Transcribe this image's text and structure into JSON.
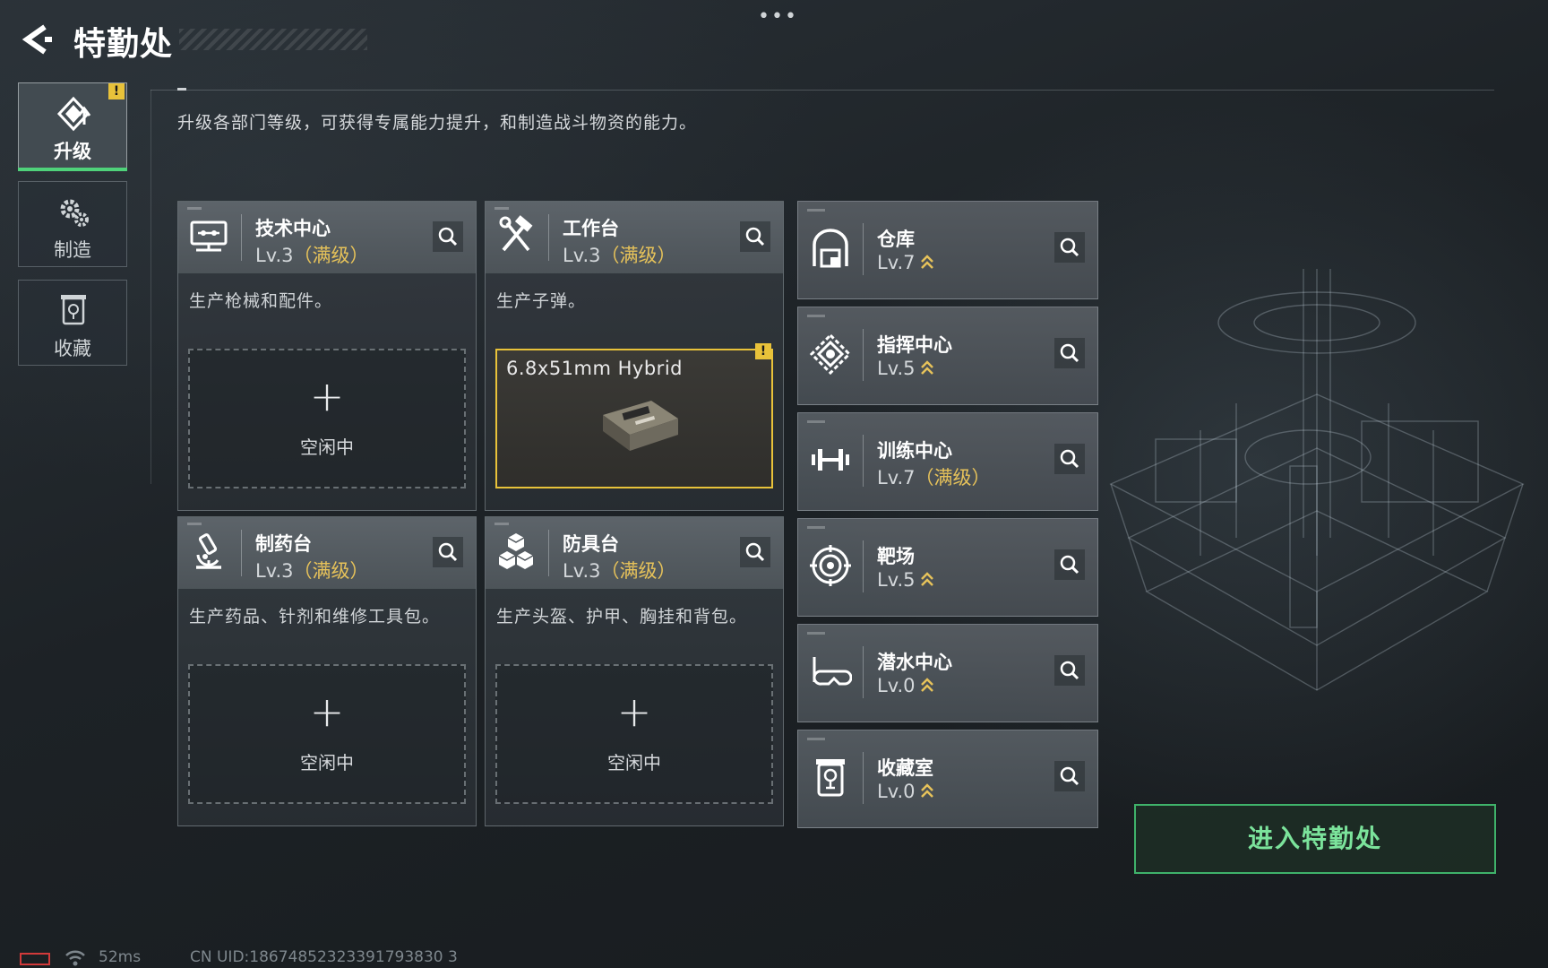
{
  "header": {
    "title": "特勤处",
    "description": "升级各部门等级，可获得专属能力提升，和制造战斗物资的能力。"
  },
  "nav": {
    "tabs": [
      {
        "label": "升级",
        "icon": "upgrade-icon",
        "active": true,
        "warning": "!"
      },
      {
        "label": "制造",
        "icon": "gears-icon",
        "active": false
      },
      {
        "label": "收藏",
        "icon": "collection-icon",
        "active": false
      }
    ]
  },
  "facilities": [
    {
      "name": "技术中心",
      "level": "Lv.3",
      "max_tag": "（满级）",
      "desc": "生产枪械和配件。",
      "icon": "monitor-icon",
      "slot": {
        "state": "idle",
        "label": "空闲中"
      }
    },
    {
      "name": "工作台",
      "level": "Lv.3",
      "max_tag": "（满级）",
      "desc": "生产子弹。",
      "icon": "hammer-wrench-icon",
      "slot": {
        "state": "producing",
        "item": "6.8x51mm Hybrid",
        "warning": "!"
      }
    },
    {
      "name": "制药台",
      "level": "Lv.3",
      "max_tag": "（满级）",
      "desc": "生产药品、针剂和维修工具包。",
      "icon": "microscope-icon",
      "slot": {
        "state": "idle",
        "label": "空闲中"
      }
    },
    {
      "name": "防具台",
      "level": "Lv.3",
      "max_tag": "（满级）",
      "desc": "生产头盔、护甲、胸挂和背包。",
      "icon": "cubes-icon",
      "slot": {
        "state": "idle",
        "label": "空闲中"
      }
    }
  ],
  "departments": [
    {
      "name": "仓库",
      "level": "Lv.7",
      "max_tag": "",
      "upgradable": true,
      "icon": "warehouse-icon"
    },
    {
      "name": "指挥中心",
      "level": "Lv.5",
      "max_tag": "",
      "upgradable": true,
      "icon": "command-icon"
    },
    {
      "name": "训练中心",
      "level": "Lv.7",
      "max_tag": "（满级）",
      "upgradable": false,
      "icon": "dumbbell-icon"
    },
    {
      "name": "靶场",
      "level": "Lv.5",
      "max_tag": "",
      "upgradable": true,
      "icon": "target-icon"
    },
    {
      "name": "潜水中心",
      "level": "Lv.0",
      "max_tag": "",
      "upgradable": true,
      "icon": "diving-mask-icon"
    },
    {
      "name": "收藏室",
      "level": "Lv.0",
      "max_tag": "",
      "upgradable": true,
      "icon": "trophy-case-icon"
    }
  ],
  "actions": {
    "enter_label": "进入特勤处"
  },
  "status_bar": {
    "ping": "52ms",
    "uid": "CN UID:18674852323391793830 3"
  },
  "colors": {
    "accent_green": "#3fb26a",
    "max_level_gold": "#e6c25a",
    "warning_yellow": "#e8c23a"
  }
}
